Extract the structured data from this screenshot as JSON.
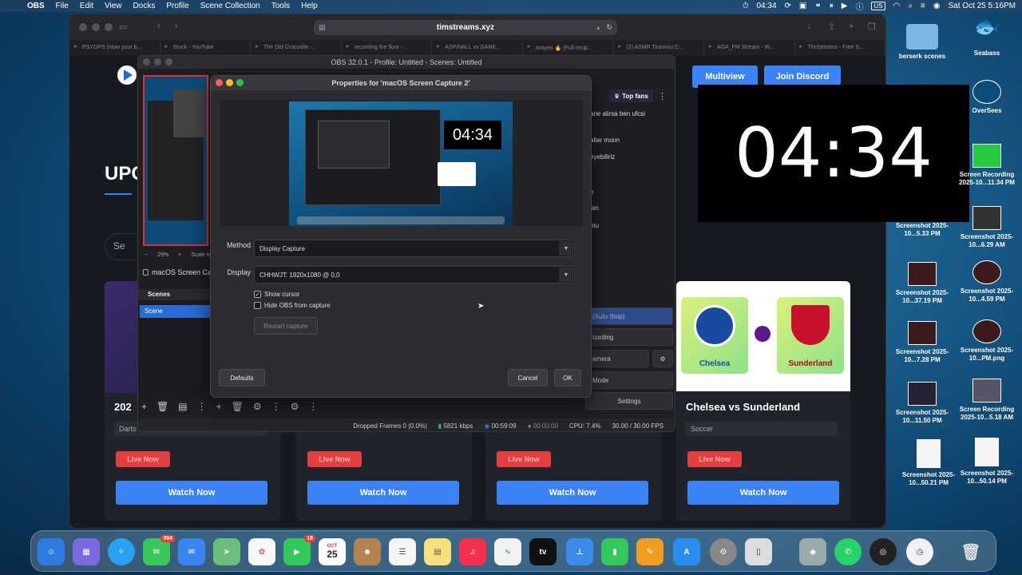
{
  "menubar": {
    "app": "OBS",
    "items": [
      "File",
      "Edit",
      "View",
      "Docks",
      "Profile",
      "Scene Collection",
      "Tools",
      "Help"
    ],
    "clock_widget": "04:34",
    "keyboard": "US",
    "datetime": "Sat Oct 25  5:16PM"
  },
  "browser": {
    "url": "timstreams.xyz",
    "tabs": [
      "PSYOPS (How your b...",
      "Stuck - YouTube",
      "The Old Crocodile -...",
      "recording the floor -...",
      "ASPINALL vs GANE...",
      "Arayes 🔥 (Full recip...",
      "(2) ASMR Tiramisu C...",
      "AGA_FM Stream - W...",
      "TimStreams - Free S..."
    ],
    "page": {
      "multiview": "Multiview",
      "join_discord": "Join Discord",
      "upcoming": "UPC",
      "search_stub": "Se",
      "cards": [
        {
          "title": "202",
          "category": "Darts",
          "live": "Live Now",
          "watch": "Watch Now"
        },
        {
          "title": "",
          "category": "",
          "live": "Live Now",
          "watch": "Watch Now"
        },
        {
          "title": "",
          "category": "",
          "live": "Live Now",
          "watch": "Watch Now"
        },
        {
          "title": "Chelsea vs Sunderland",
          "category": "Soccer",
          "live": "Live Now",
          "watch": "Watch Now",
          "team1": "Chelsea",
          "team2": "Sunderland"
        }
      ]
    }
  },
  "obs": {
    "title": "OBS 32.0.1 - Profile: Untitled - Scenes: Untitled",
    "zoom": "29%",
    "scale_label": "Scale to",
    "source_name": "macOS Screen Ca",
    "scenes_header": "Scenes",
    "scene_item": "Scene",
    "top_fans": "Top fans",
    "chat_lines": [
      "ane alirsa ben ufcsi",
      "allar mısın",
      "eyebiliriz",
      "n",
      "lan",
      "mu"
    ],
    "controls": [
      "(Auto Stop)",
      "cording",
      "amera",
      "Mode",
      "Settings"
    ],
    "status": {
      "dropped": "Dropped Frames 0 (0.0%)",
      "bitrate": "5821 kbps",
      "rec_time": "00:59:09",
      "stream_time": "00:00:00",
      "cpu": "CPU: 7.4%",
      "fps": "30.00 / 30.00 FPS"
    }
  },
  "props": {
    "title": "Properties for 'macOS Screen Capture 2'",
    "preview_clock": "04:34",
    "method_label": "Method",
    "method_value": "Display Capture",
    "display_label": "Display",
    "display_value": "CHHWJT: 1920x1080 @ 0,0",
    "show_cursor": "Show cursor",
    "show_cursor_checked": true,
    "hide_obs": "Hide OBS from capture",
    "hide_obs_checked": false,
    "restart": "Restart capture",
    "defaults": "Defaults",
    "cancel": "Cancel",
    "ok": "OK"
  },
  "big_clock": "04:34",
  "desktop_icons": [
    {
      "label": "berserk scenes"
    },
    {
      "label": "Seabass"
    },
    {
      "label": "OverSees"
    },
    {
      "label": "Screen Recording 2025-10...11.34 PM"
    },
    {
      "label": "Screenshot 2025-10...5.33 PM"
    },
    {
      "label": "Screenshot 2025-10...6.29 AM"
    },
    {
      "label": "Screenshot 2025-10...37.19 PM"
    },
    {
      "label": "Screenshot 2025-10...4.59 PM"
    },
    {
      "label": "Screenshot 2025-10...7.28 PM"
    },
    {
      "label": "Screenshot 2025-10...PM.png"
    },
    {
      "label": "Screenshot 2025-10...11.50 PM"
    },
    {
      "label": "Screen Recording 2025-10...5.18 AM"
    },
    {
      "label": "Screenshot 2025-10...50.21 PM"
    },
    {
      "label": "Screenshot 2025-10...50.14 PM"
    }
  ],
  "dock": {
    "messages_badge": "394",
    "facetime_badge": "18",
    "calendar_month": "OCT",
    "calendar_day": "25",
    "tv_label": "tv"
  }
}
